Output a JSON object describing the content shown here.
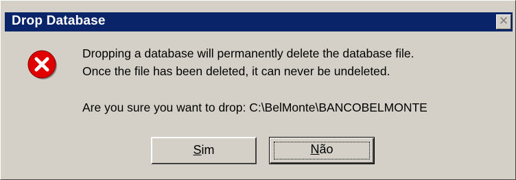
{
  "window": {
    "title": "Drop Database",
    "close_glyph": "✕"
  },
  "icon": {
    "name": "error-icon",
    "color": "#e00000"
  },
  "message": {
    "line1": "Dropping a database will permanently delete the database file.",
    "line2": "Once the file has been deleted, it can never be undeleted.",
    "line3": "Are you sure you want to drop: C:\\BelMonte\\BANCOBELMONTE"
  },
  "buttons": {
    "yes": {
      "accel": "S",
      "rest": "im"
    },
    "no": {
      "accel": "N",
      "rest": "ão",
      "focused": true
    }
  },
  "colors": {
    "titlebar": "#0a246a",
    "face": "#d4d0c8"
  }
}
